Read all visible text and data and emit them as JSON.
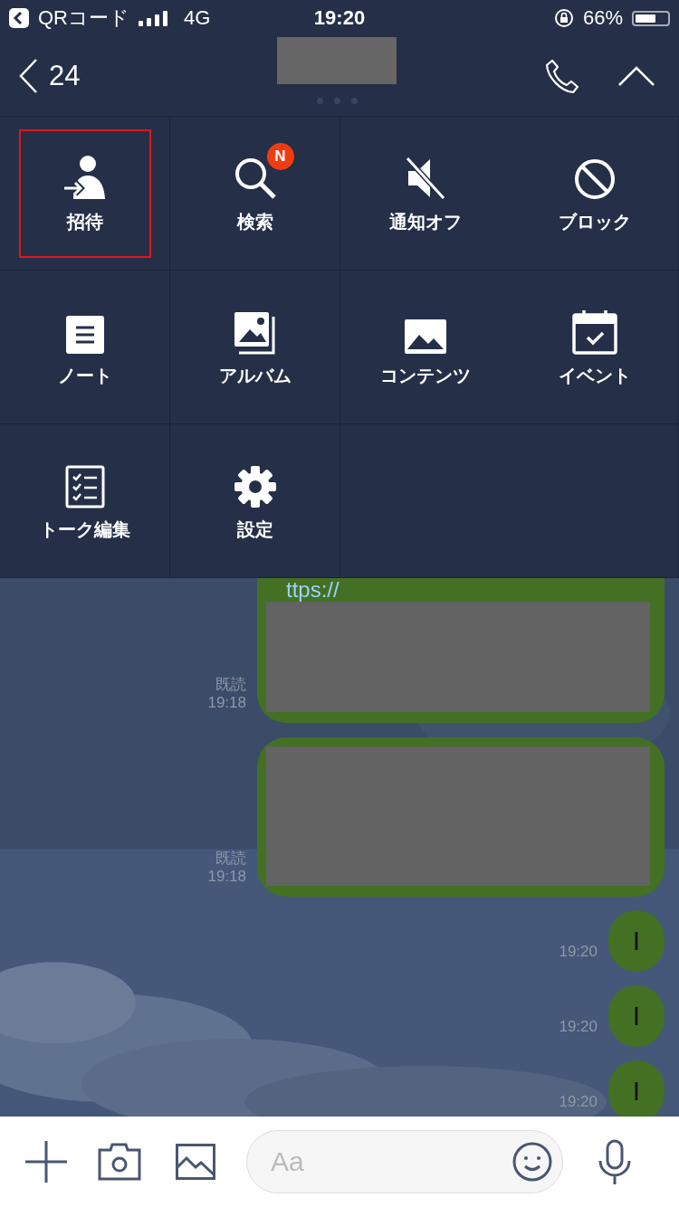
{
  "status_bar": {
    "back_app": "QRコード",
    "network": "4G",
    "time": "19:20",
    "battery": "66%"
  },
  "header": {
    "back_count": "24"
  },
  "menu": [
    {
      "kind": "invite",
      "label": "招待",
      "highlighted": true
    },
    {
      "kind": "search",
      "label": "検索",
      "highlighted": false,
      "badge": "N"
    },
    {
      "kind": "mute",
      "label": "通知オフ",
      "highlighted": false
    },
    {
      "kind": "block",
      "label": "ブロック",
      "highlighted": false
    },
    {
      "kind": "note",
      "label": "ノート",
      "highlighted": false
    },
    {
      "kind": "album",
      "label": "アルバム",
      "highlighted": false
    },
    {
      "kind": "contents",
      "label": "コンテンツ",
      "highlighted": false
    },
    {
      "kind": "event",
      "label": "イベント",
      "highlighted": false
    },
    {
      "kind": "edit",
      "label": "トーク編集",
      "highlighted": false
    },
    {
      "kind": "settings",
      "label": "設定",
      "highlighted": false
    }
  ],
  "messages": [
    {
      "kind": "redacted",
      "text": "ttps://",
      "read": "既読",
      "time": "19:18"
    },
    {
      "kind": "redacted",
      "read": "既読",
      "time": "19:18"
    },
    {
      "kind": "text",
      "text": "I",
      "time": "19:20"
    },
    {
      "kind": "text",
      "text": "I",
      "time": "19:20"
    },
    {
      "kind": "text",
      "text": "I",
      "time": "19:20"
    }
  ],
  "composer": {
    "placeholder": "Aa"
  }
}
